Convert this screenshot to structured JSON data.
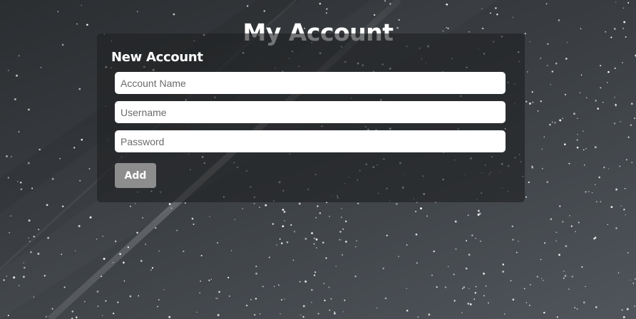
{
  "page": {
    "title": "My Account"
  },
  "form": {
    "heading": "New Account",
    "fields": [
      {
        "placeholder": "Account Name",
        "value": ""
      },
      {
        "placeholder": "Username",
        "value": ""
      },
      {
        "placeholder": "Password",
        "value": ""
      }
    ],
    "submit_label": "Add"
  },
  "colors": {
    "background": "#3a3e42",
    "card": "#1e2022",
    "button": "#8d8d8d",
    "text": "#ffffff"
  }
}
